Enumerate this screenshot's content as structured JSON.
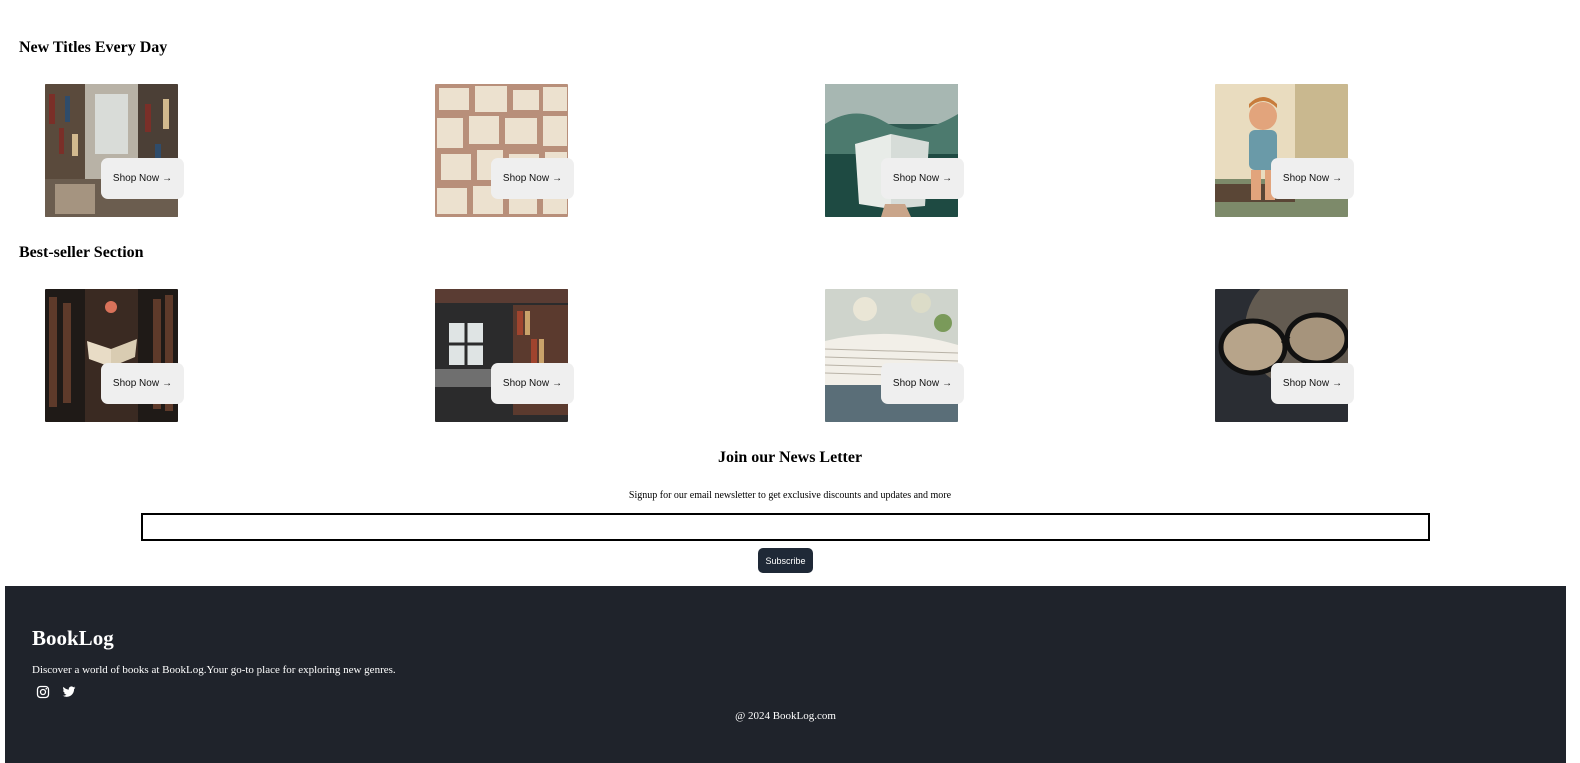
{
  "sections": {
    "new_titles": {
      "title": "New Titles Every Day",
      "cards": [
        {
          "button_label": "Shop Now",
          "image": "library-stacks-photo"
        },
        {
          "button_label": "Shop Now",
          "image": "open-book-pages-photo"
        },
        {
          "button_label": "Shop Now",
          "image": "book-in-forest-photo"
        },
        {
          "button_label": "Shop Now",
          "image": "laughing-child-photo"
        }
      ]
    },
    "best_sellers": {
      "title": "Best-seller Section",
      "cards": [
        {
          "button_label": "Shop Now",
          "image": "dark-library-open-book-photo"
        },
        {
          "button_label": "Shop Now",
          "image": "reading-nook-window-photo"
        },
        {
          "button_label": "Shop Now",
          "image": "open-book-closeup-photo"
        },
        {
          "button_label": "Shop Now",
          "image": "eyeglasses-photo"
        }
      ]
    }
  },
  "newsletter": {
    "title": "Join our News Letter",
    "description": "Signup for our email newsletter to get exclusive discounts and updates and more",
    "email_value": "",
    "subscribe_label": "Subscribe"
  },
  "footer": {
    "brand": "BookLog",
    "tagline": "Discover a world of books at BookLog.Your go-to place for exploring new genres.",
    "social_icons": [
      "instagram-icon",
      "twitter-icon"
    ],
    "copyright": "@ 2024 BookLog.com"
  },
  "colors": {
    "footer_bg": "#1f232b",
    "subscribe_bg": "#1f2937",
    "shop_button_bg": "#efefef"
  }
}
